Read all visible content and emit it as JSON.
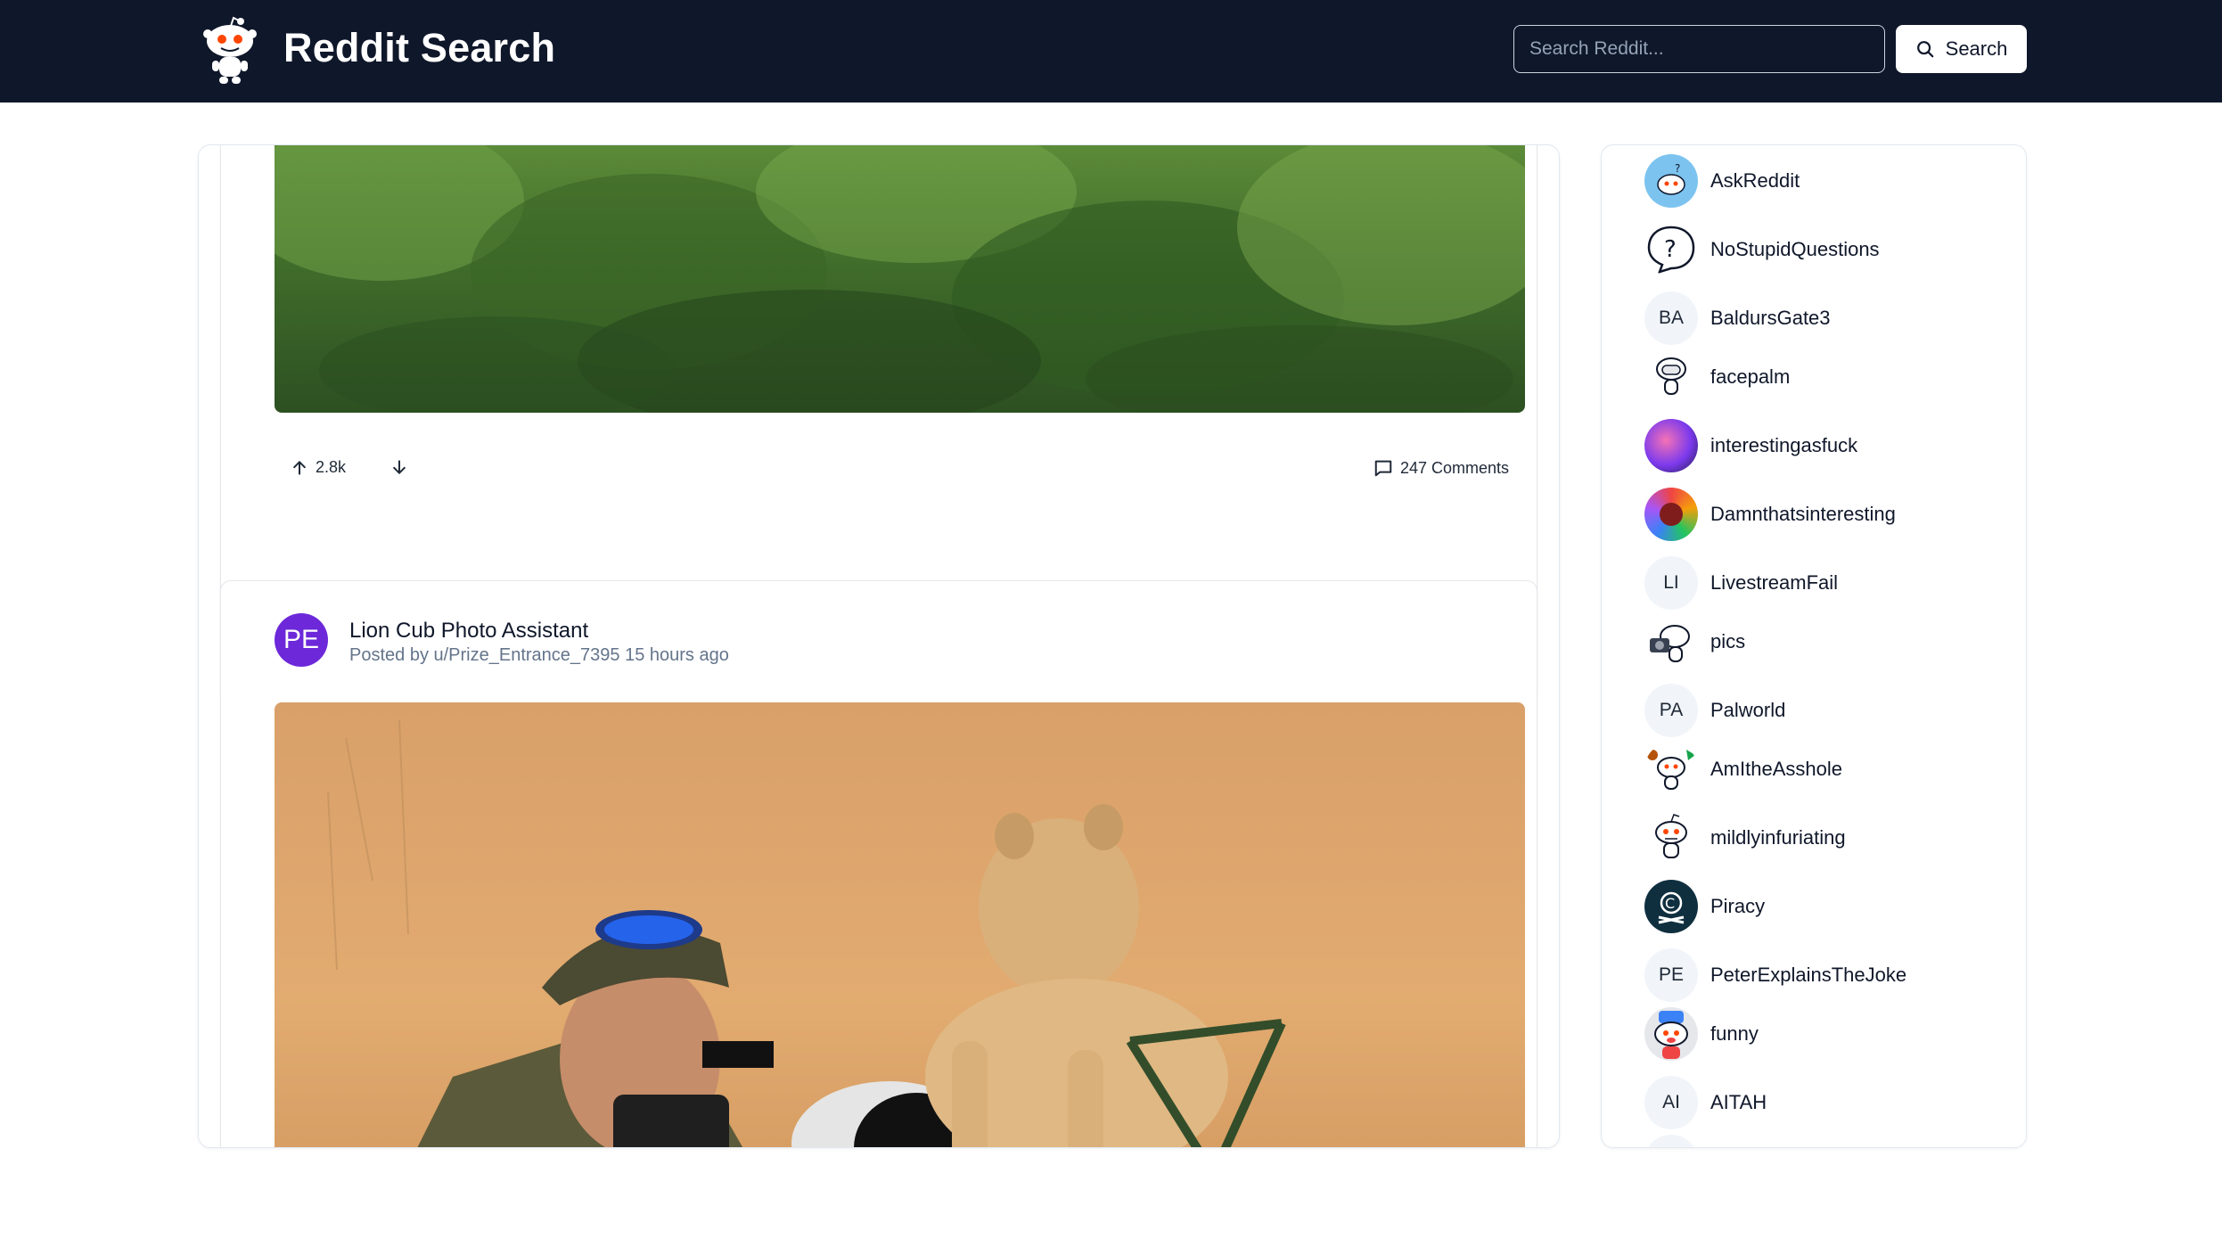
{
  "header": {
    "title": "Reddit Search",
    "search_placeholder": "Search Reddit...",
    "search_button": "Search"
  },
  "post1": {
    "upvotes": "2.8k",
    "comments": "247 Comments"
  },
  "post2": {
    "avatar_initials": "PE",
    "title": "Lion Cub Photo Assistant",
    "meta": "Posted by u/Prize_Entrance_7395 15 hours ago"
  },
  "sidebar": {
    "subreddits": [
      {
        "name": "AskReddit",
        "icon": "askreddit-icon"
      },
      {
        "name": "NoStupidQuestions",
        "icon": "question-mark-icon"
      },
      {
        "name": "BaldursGate3",
        "initials": "BA"
      },
      {
        "name": "facepalm",
        "icon": "facepalm-icon"
      },
      {
        "name": "interestingasfuck",
        "icon": "interestingasfuck-icon"
      },
      {
        "name": "Damnthatsinteresting",
        "icon": "damnthatsinteresting-icon"
      },
      {
        "name": "LivestreamFail",
        "initials": "LI"
      },
      {
        "name": "pics",
        "icon": "pics-icon"
      },
      {
        "name": "Palworld",
        "initials": "PA"
      },
      {
        "name": "AmItheAsshole",
        "icon": "amitheasshole-icon"
      },
      {
        "name": "mildlyinfuriating",
        "icon": "mildlyinfuriating-icon"
      },
      {
        "name": "Piracy",
        "icon": "piracy-icon"
      },
      {
        "name": "PeterExplainsTheJoke",
        "initials": "PE"
      },
      {
        "name": "funny",
        "icon": "funny-icon"
      },
      {
        "name": "AITAH",
        "initials": "AI"
      }
    ]
  }
}
